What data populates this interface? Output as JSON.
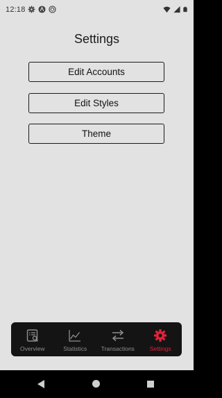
{
  "status_bar": {
    "time": "12:18",
    "icons_left": [
      "gear-icon",
      "android-icon",
      "sync-icon"
    ],
    "icons_right": [
      "wifi-icon",
      "signal-icon",
      "battery-icon"
    ]
  },
  "page": {
    "title": "Settings"
  },
  "menu": {
    "edit_accounts": "Edit Accounts",
    "edit_styles": "Edit Styles",
    "theme": "Theme"
  },
  "bottom_nav": {
    "items": [
      {
        "label": "Overview",
        "icon": "overview-icon",
        "active": false
      },
      {
        "label": "Statistics",
        "icon": "chart-icon",
        "active": false
      },
      {
        "label": "Transactions",
        "icon": "transfer-icon",
        "active": false
      },
      {
        "label": "Settings",
        "icon": "gear-icon",
        "active": true
      }
    ],
    "active_color": "#e0243a",
    "inactive_color": "#8f8f8f",
    "background": "#141414"
  },
  "system_nav": {
    "buttons": [
      "back-icon",
      "home-icon",
      "recents-icon"
    ]
  },
  "colors": {
    "screen_background": "#e2e2e2",
    "text": "#1a1a1a"
  }
}
